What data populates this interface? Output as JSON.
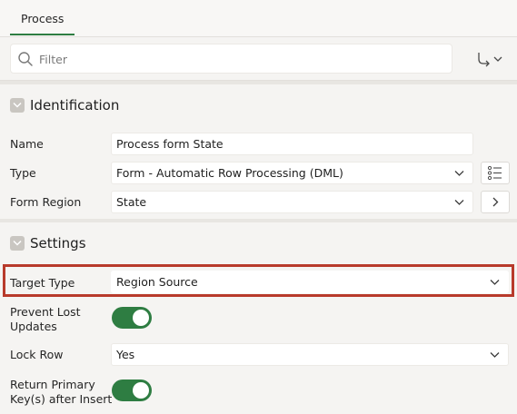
{
  "tabs": [
    {
      "label": "Process",
      "active": true
    }
  ],
  "filter": {
    "placeholder": "Filter",
    "value": ""
  },
  "sections": {
    "identification": {
      "title": "Identification",
      "name": {
        "label": "Name",
        "value": "Process form State"
      },
      "type": {
        "label": "Type",
        "value": "Form - Automatic Row Processing (DML)"
      },
      "form_region": {
        "label": "Form Region",
        "value": "State"
      }
    },
    "settings": {
      "title": "Settings",
      "target_type": {
        "label": "Target Type",
        "value": "Region Source",
        "highlighted": true
      },
      "prevent_lost_updates": {
        "label_line1": "Prevent Lost",
        "label_line2": "Updates",
        "on": true
      },
      "lock_row": {
        "label": "Lock Row",
        "value": "Yes"
      },
      "return_pk": {
        "label_line1": "Return Primary",
        "label_line2": "Key(s) after Insert",
        "on": true
      }
    }
  },
  "colors": {
    "accent": "#2e7d42",
    "highlight": "#b83a2b"
  },
  "icons": [
    "search-icon",
    "goto-group-icon",
    "chevron-down-icon",
    "list-icon",
    "chevron-right-icon"
  ]
}
